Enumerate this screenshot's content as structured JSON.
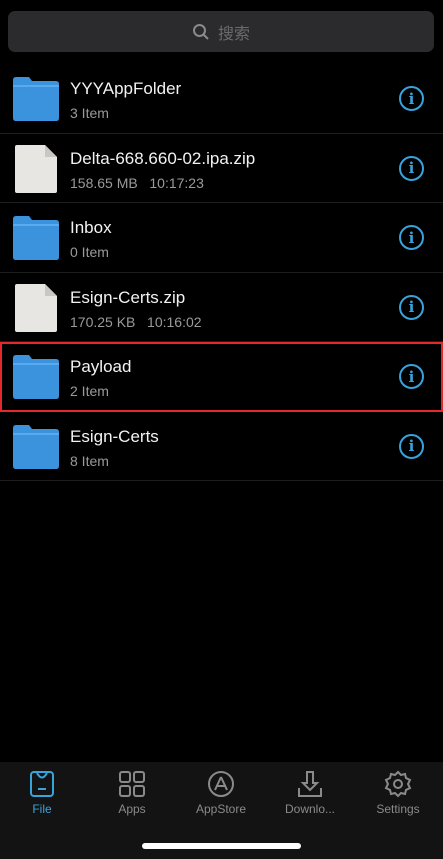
{
  "search": {
    "placeholder": "搜索"
  },
  "files": [
    {
      "name": "YYYAppFolder",
      "sub": "3 Item",
      "type": "folder"
    },
    {
      "name": "Delta-668.660-02.ipa.zip",
      "sub": "158.65 MB   10:17:23",
      "type": "file"
    },
    {
      "name": "Inbox",
      "sub": "0 Item",
      "type": "folder"
    },
    {
      "name": "Esign-Certs.zip",
      "sub": "170.25 KB   10:16:02",
      "type": "file"
    },
    {
      "name": "Payload",
      "sub": "2 Item",
      "type": "folder",
      "highlighted": true
    },
    {
      "name": "Esign-Certs",
      "sub": "8 Item",
      "type": "folder"
    }
  ],
  "tabs": [
    {
      "label": "File",
      "active": true
    },
    {
      "label": "Apps"
    },
    {
      "label": "AppStore"
    },
    {
      "label": "Downlo..."
    },
    {
      "label": "Settings"
    }
  ],
  "colors": {
    "accent": "#3aa3dc",
    "highlight": "#e5282c",
    "folder": "#3b93dd"
  }
}
